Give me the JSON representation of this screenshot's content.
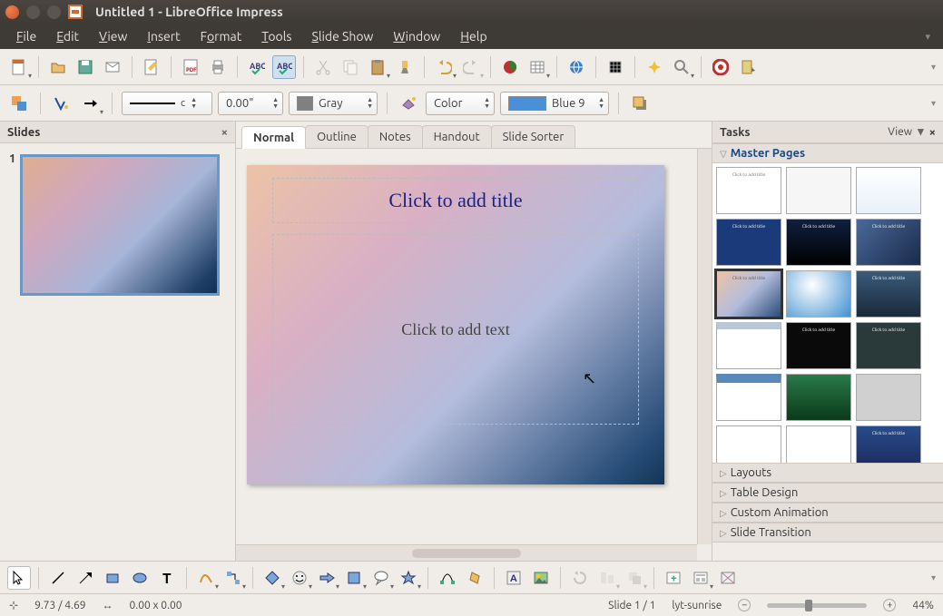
{
  "window": {
    "title": "Untitled 1 - LibreOffice Impress"
  },
  "menu": {
    "items": [
      "File",
      "Edit",
      "View",
      "Insert",
      "Format",
      "Tools",
      "Slide Show",
      "Window",
      "Help"
    ]
  },
  "toolbar2": {
    "line_style": "c",
    "line_width": "0.00\"",
    "line_color_label": "Gray",
    "fill_mode": "Color",
    "fill_color_label": "Blue 9"
  },
  "slides_panel": {
    "title": "Slides",
    "thumb_number": "1"
  },
  "tabs": {
    "items": [
      {
        "label": "Normal",
        "active": true
      },
      {
        "label": "Outline",
        "active": false
      },
      {
        "label": "Notes",
        "active": false
      },
      {
        "label": "Handout",
        "active": false
      },
      {
        "label": "Slide Sorter",
        "active": false
      }
    ]
  },
  "slide": {
    "title_placeholder": "Click to add title",
    "text_placeholder": "Click to add text"
  },
  "tasks_panel": {
    "title": "Tasks",
    "view_link": "View",
    "sections": [
      "Master Pages",
      "Layouts",
      "Table Design",
      "Custom Animation",
      "Slide Transition"
    ]
  },
  "statusbar": {
    "coords": "9.73 / 4.69",
    "size": "0.00 x 0.00",
    "slide_info": "Slide 1 / 1",
    "layout_name": "lyt-sunrise",
    "zoom_pct": "44%"
  }
}
